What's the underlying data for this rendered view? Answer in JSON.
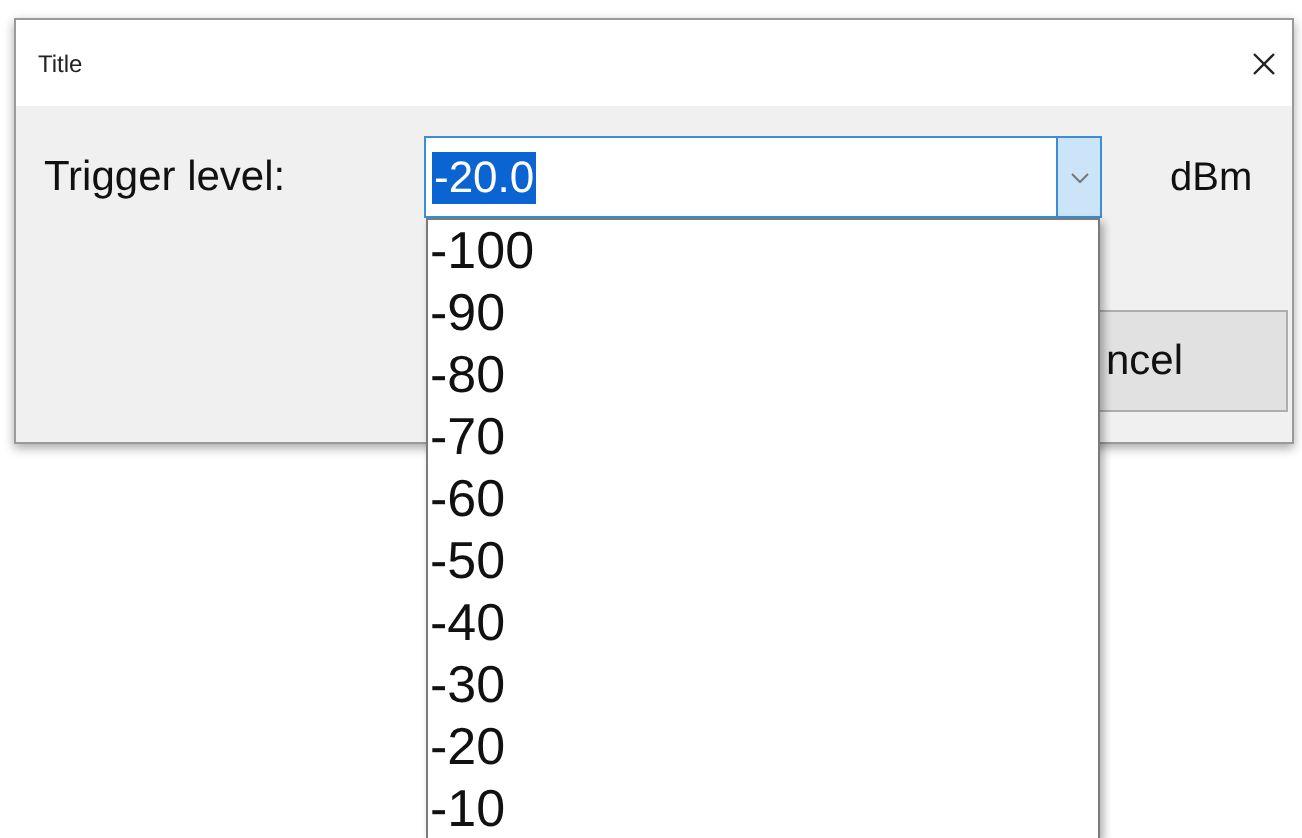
{
  "window": {
    "title": "Title"
  },
  "trigger": {
    "label": "Trigger level:",
    "value": "-20.0",
    "value_selected": true,
    "unit": "dBm",
    "expanded": true
  },
  "options": [
    {
      "label": "-100",
      "selected": false
    },
    {
      "label": "-90",
      "selected": false
    },
    {
      "label": "-80",
      "selected": false
    },
    {
      "label": "-70",
      "selected": false
    },
    {
      "label": "-60",
      "selected": false
    },
    {
      "label": "-50",
      "selected": false
    },
    {
      "label": "-40",
      "selected": false
    },
    {
      "label": "-30",
      "selected": false
    },
    {
      "label": "-20",
      "selected": false
    },
    {
      "label": "-10",
      "selected": false
    }
  ],
  "buttons": [
    {
      "label": "ncel"
    }
  ]
}
